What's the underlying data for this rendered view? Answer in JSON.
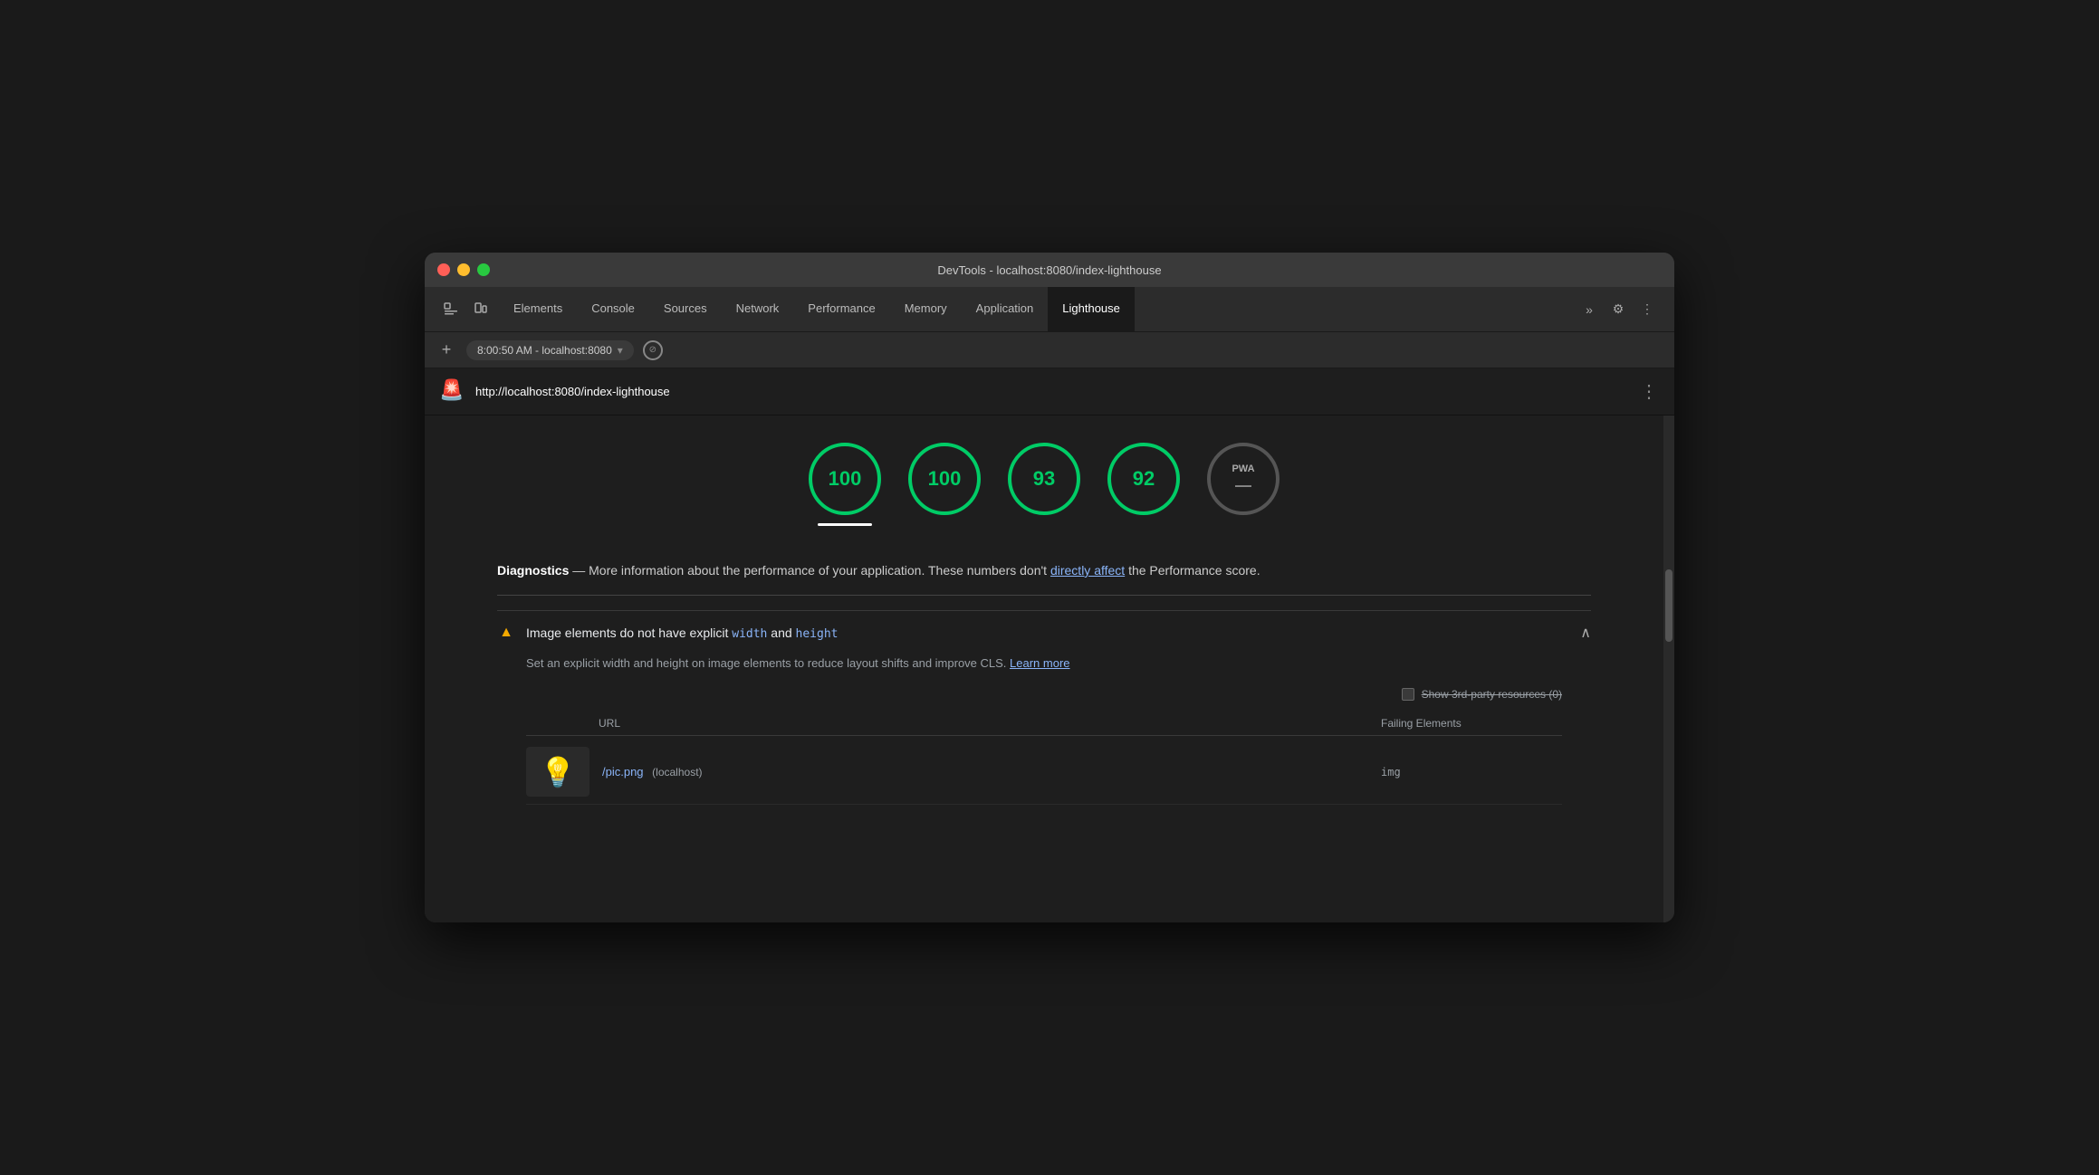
{
  "window": {
    "title": "DevTools - localhost:8080/index-lighthouse"
  },
  "traffic_lights": {
    "red": "red-button",
    "yellow": "yellow-button",
    "green": "green-button"
  },
  "tabs": {
    "items": [
      {
        "label": "Elements",
        "active": false
      },
      {
        "label": "Console",
        "active": false
      },
      {
        "label": "Sources",
        "active": false
      },
      {
        "label": "Network",
        "active": false
      },
      {
        "label": "Performance",
        "active": false
      },
      {
        "label": "Memory",
        "active": false
      },
      {
        "label": "Application",
        "active": false
      },
      {
        "label": "Lighthouse",
        "active": true
      }
    ],
    "more_label": "»",
    "settings_icon": "⚙",
    "dots_icon": "⋮"
  },
  "address_bar": {
    "time": "8:00:50 AM",
    "url": "localhost:8080",
    "stop_icon": "⊘"
  },
  "lighthouse_url_bar": {
    "icon": "🚨",
    "url": "http://localhost:8080/index-lighthouse",
    "kebab": "⋮"
  },
  "scores": [
    {
      "value": "100",
      "selected": true
    },
    {
      "value": "100",
      "selected": false
    },
    {
      "value": "93",
      "selected": false
    },
    {
      "value": "92",
      "selected": false
    }
  ],
  "pwa": {
    "label": "PWA",
    "dash": "—"
  },
  "diagnostics": {
    "heading": "Diagnostics",
    "description": " — More information about the performance of your application. These numbers don't ",
    "link_text": "directly affect",
    "description2": " the Performance score."
  },
  "audit": {
    "warning_icon": "▲",
    "title_prefix": "Image elements do not have explicit ",
    "code1": "width",
    "title_middle": " and ",
    "code2": "height",
    "chevron": "∧",
    "description": "Set an explicit width and height on image elements to reduce layout shifts and improve CLS. ",
    "learn_more": "Learn more",
    "third_party_label": "Show 3rd-party resources (0)",
    "table": {
      "col_url": "URL",
      "col_failing": "Failing Elements",
      "rows": [
        {
          "url": "/pic.png",
          "host": "(localhost)",
          "failing": "img",
          "thumb_emoji": "💡"
        }
      ]
    }
  }
}
